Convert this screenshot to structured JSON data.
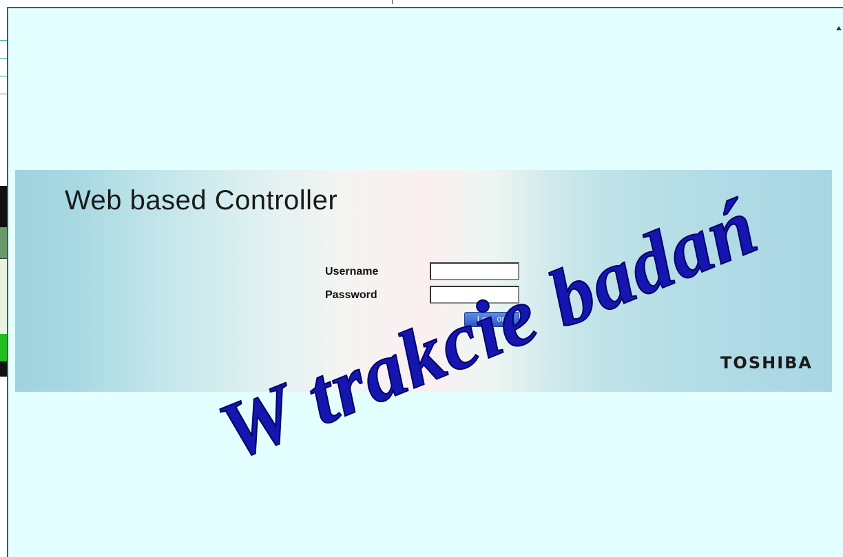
{
  "app": {
    "title": "Web based Controller",
    "brand": "TOSHIBA"
  },
  "login": {
    "username_label": "Username",
    "password_label": "Password",
    "username_value": "",
    "password_value": "",
    "submit_label": "Log on"
  },
  "overlay": {
    "watermark_text": "W trakcie badań"
  },
  "colors": {
    "page_background": "#e4ffff",
    "button_blue": "#2b55c6",
    "watermark_blue": "#1515b0"
  }
}
